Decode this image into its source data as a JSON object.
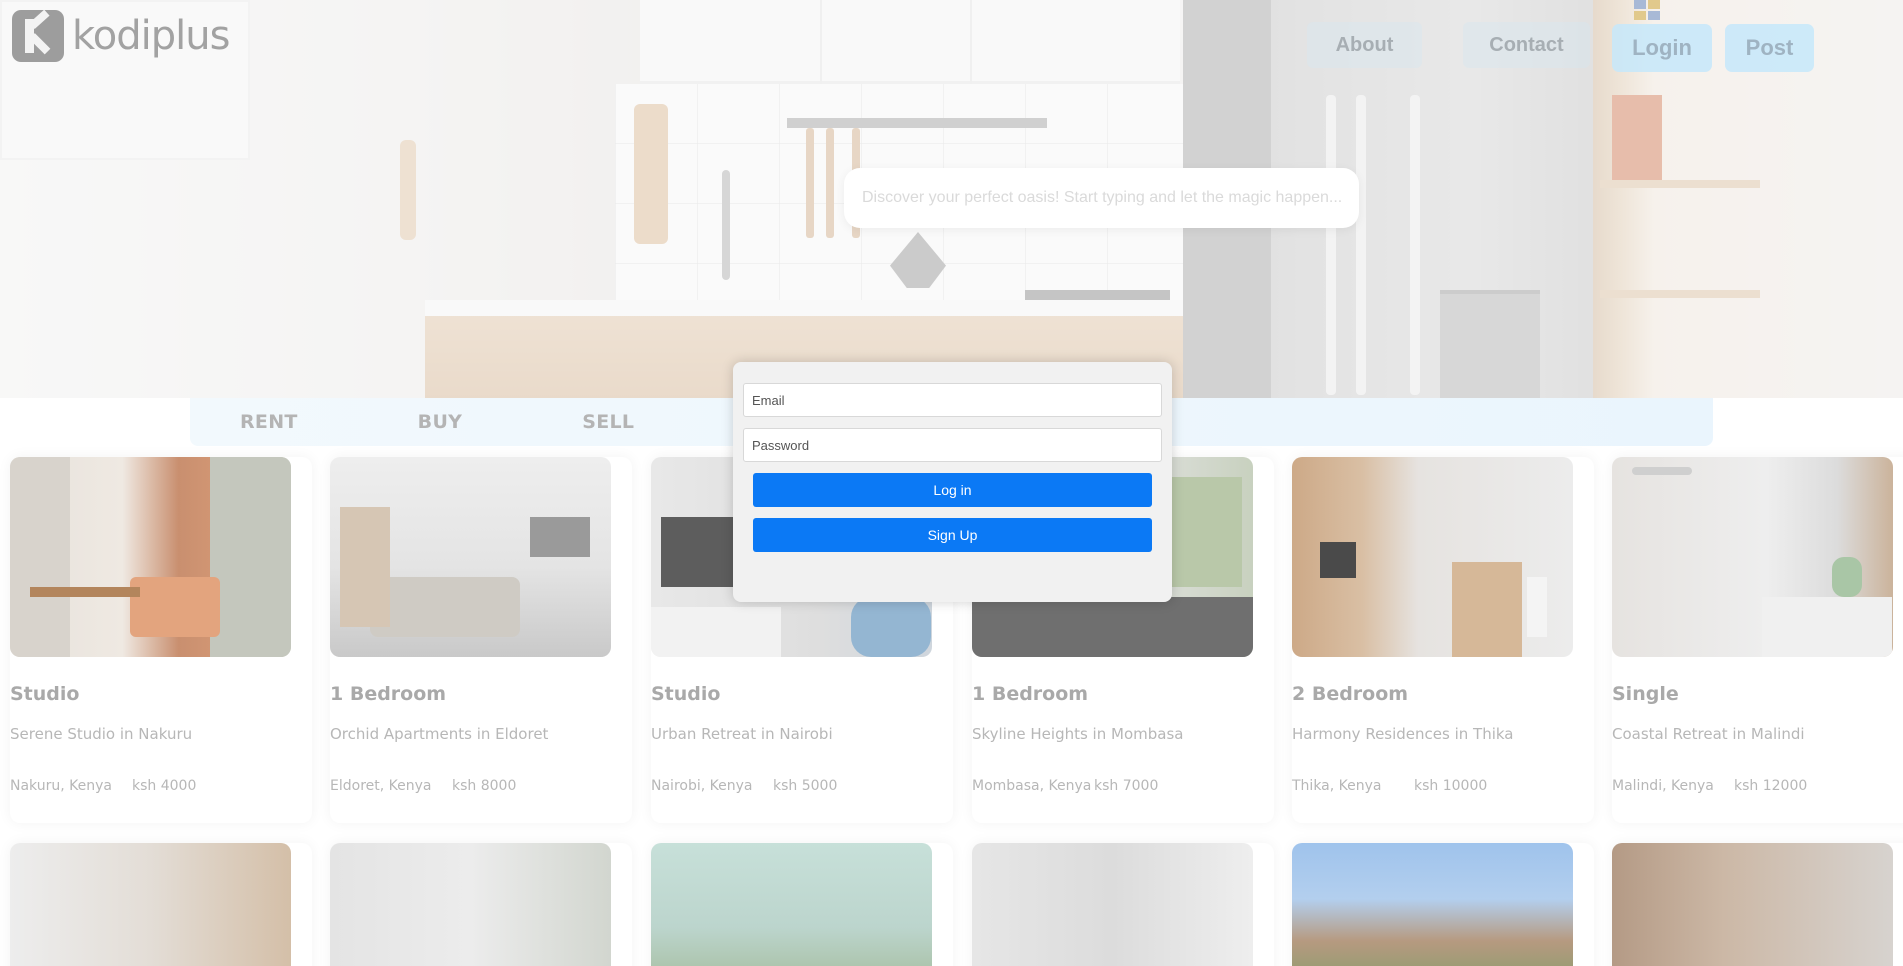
{
  "brand": {
    "name": "kodiplus"
  },
  "nav": {
    "about_label": "About",
    "contact_label": "Contact",
    "login_label": "Login",
    "post_label": "Post"
  },
  "search": {
    "placeholder": "Discover your perfect oasis! Start typing and let the magic happen...",
    "value": ""
  },
  "tabs": [
    {
      "label": "RENT"
    },
    {
      "label": "BUY"
    },
    {
      "label": "SELL"
    }
  ],
  "listings": [
    {
      "type": "Studio",
      "title": "Serene Studio in Nakuru",
      "location": "Nakuru, Kenya",
      "price": "ksh 4000"
    },
    {
      "type": "1 Bedroom",
      "title": "Orchid Apartments in Eldoret",
      "location": "Eldoret, Kenya",
      "price": "ksh 8000"
    },
    {
      "type": "Studio",
      "title": "Urban Retreat in Nairobi",
      "location": "Nairobi, Kenya",
      "price": "ksh 5000"
    },
    {
      "type": "1 Bedroom",
      "title": "Skyline Heights in Mombasa",
      "location": "Mombasa, Kenya",
      "price": "ksh 7000"
    },
    {
      "type": "2 Bedroom",
      "title": "Harmony Residences in Thika",
      "location": "Thika, Kenya",
      "price": "ksh 10000"
    },
    {
      "type": "Single",
      "title": "Coastal Retreat in Malindi",
      "location": "Malindi, Kenya",
      "price": "ksh 12000"
    }
  ],
  "login_modal": {
    "email_placeholder": "Email",
    "email_value": "",
    "password_placeholder": "Password",
    "password_value": "",
    "login_label": "Log in",
    "signup_label": "Sign Up"
  },
  "colors": {
    "primary_button": "#0b79f5",
    "nav_button_bg": "#c6e8fa",
    "tabbar_bg": "#eaf5fd"
  }
}
